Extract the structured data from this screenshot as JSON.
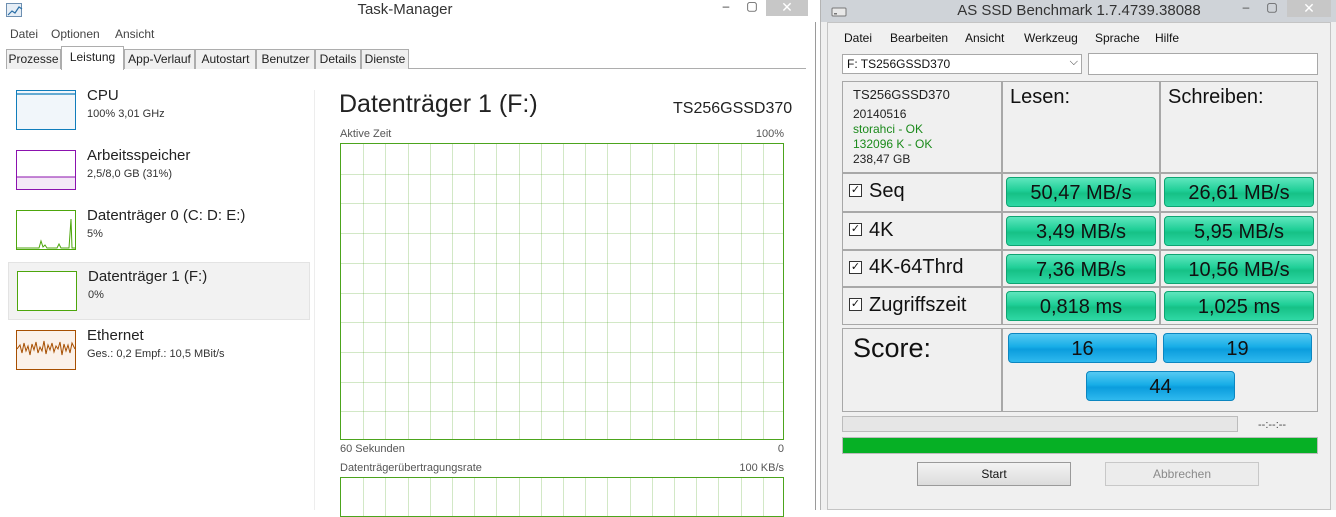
{
  "task_manager": {
    "title": "Task-Manager",
    "menu": [
      "Datei",
      "Optionen",
      "Ansicht"
    ],
    "tabs": [
      "Prozesse",
      "Leistung",
      "App-Verlauf",
      "Autostart",
      "Benutzer",
      "Details",
      "Dienste"
    ],
    "active_tab": "Leistung",
    "sidebar": [
      {
        "name": "CPU",
        "sub": "100% 3,01 GHz",
        "color": "#117dbb"
      },
      {
        "name": "Arbeitsspeicher",
        "sub": "2,5/8,0 GB (31%)",
        "color": "#8b12ae"
      },
      {
        "name": "Datenträger 0 (C: D: E:)",
        "sub": "5%",
        "color": "#4da60c"
      },
      {
        "name": "Datenträger 1 (F:)",
        "sub": "0%",
        "color": "#4da60c"
      },
      {
        "name": "Ethernet",
        "sub": "Ges.: 0,2  Empf.: 10,5 MBit/s",
        "color": "#a74f01"
      }
    ],
    "selected_index": 3,
    "detail": {
      "title": "Datenträger 1 (F:)",
      "model": "TS256GSSD370",
      "active_time_label": "Aktive Zeit",
      "active_time_max": "100%",
      "time_span_label": "60 Sekunden",
      "time_span_min": "0",
      "rate_label": "Datenträgerübertragungsrate",
      "rate_max": "100 KB/s"
    },
    "graph_color": "#4ca41d"
  },
  "as_ssd": {
    "title": "AS SSD Benchmark 1.7.4739.38088",
    "menu": [
      "Datei",
      "Bearbeiten",
      "Ansicht",
      "Werkzeug",
      "Sprache",
      "Hilfe"
    ],
    "drive_select": "F: TS256GSSD370",
    "drive_info": {
      "model": "TS256GSSD370",
      "firmware": "20140516",
      "driver": "storahci - OK",
      "alignment": "132096 K - OK",
      "size": "238,47 GB"
    },
    "header_read": "Lesen:",
    "header_write": "Schreiben:",
    "rows": [
      {
        "label": "Seq",
        "read": "50,47 MB/s",
        "write": "26,61 MB/s"
      },
      {
        "label": "4K",
        "read": "3,49 MB/s",
        "write": "5,95 MB/s"
      },
      {
        "label": "4K-64Thrd",
        "read": "7,36 MB/s",
        "write": "10,56 MB/s"
      },
      {
        "label": "Zugriffszeit",
        "read": "0,818 ms",
        "write": "1,025 ms"
      }
    ],
    "score_label": "Score:",
    "score_read": "16",
    "score_write": "19",
    "score_total": "44",
    "elapsed_time": "--:--:--",
    "progress_fraction": 1.0,
    "progress_color": "#06b025",
    "start_button": "Start",
    "abort_button": "Abbrechen"
  }
}
